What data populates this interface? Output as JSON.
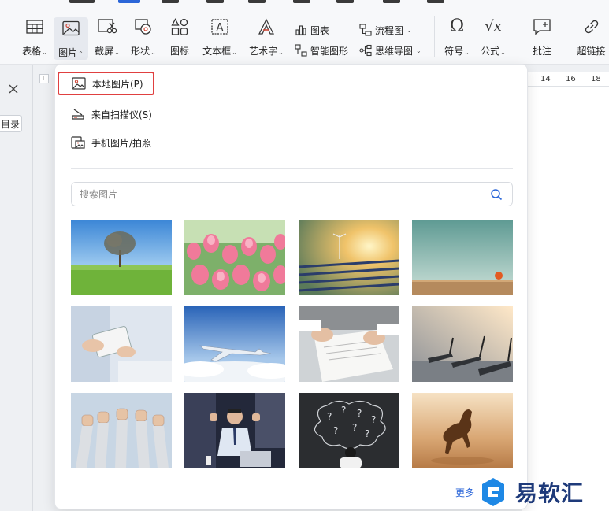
{
  "ribbon": {
    "tools": {
      "table": "表格",
      "image": "图片",
      "screenshot": "截屏",
      "shape": "形状",
      "icon": "图标",
      "textbox": "文本框",
      "wordart": "艺术字",
      "chart": "图表",
      "smartart": "智能图形",
      "flowchart": "流程图",
      "mindmap": "思维导图",
      "symbol": "符号",
      "formula": "公式",
      "comment": "批注",
      "hyperlink": "超链接"
    }
  },
  "left_panel": {
    "toc_label": "目录"
  },
  "ruler": {
    "marks": [
      "14",
      "16",
      "18"
    ]
  },
  "image_menu": {
    "local_image": "本地图片(P)",
    "from_scanner": "来自扫描仪(S)",
    "phone_image": "手机图片/拍照",
    "search_placeholder": "搜索图片",
    "more": "更多",
    "thumbnails": [
      "tree-field",
      "tulips",
      "solar-sunset",
      "apple-wall",
      "tablet-hands",
      "airplane-sky",
      "documents-signing",
      "gym-treadmills",
      "raised-fists",
      "businessman-cheering",
      "question-chalkboard",
      "running-horse"
    ]
  },
  "watermark": {
    "text": "易软汇"
  },
  "colors": {
    "accent": "#2b66d8",
    "highlight_border": "#e04040",
    "watermark": "#1e3a7a"
  }
}
